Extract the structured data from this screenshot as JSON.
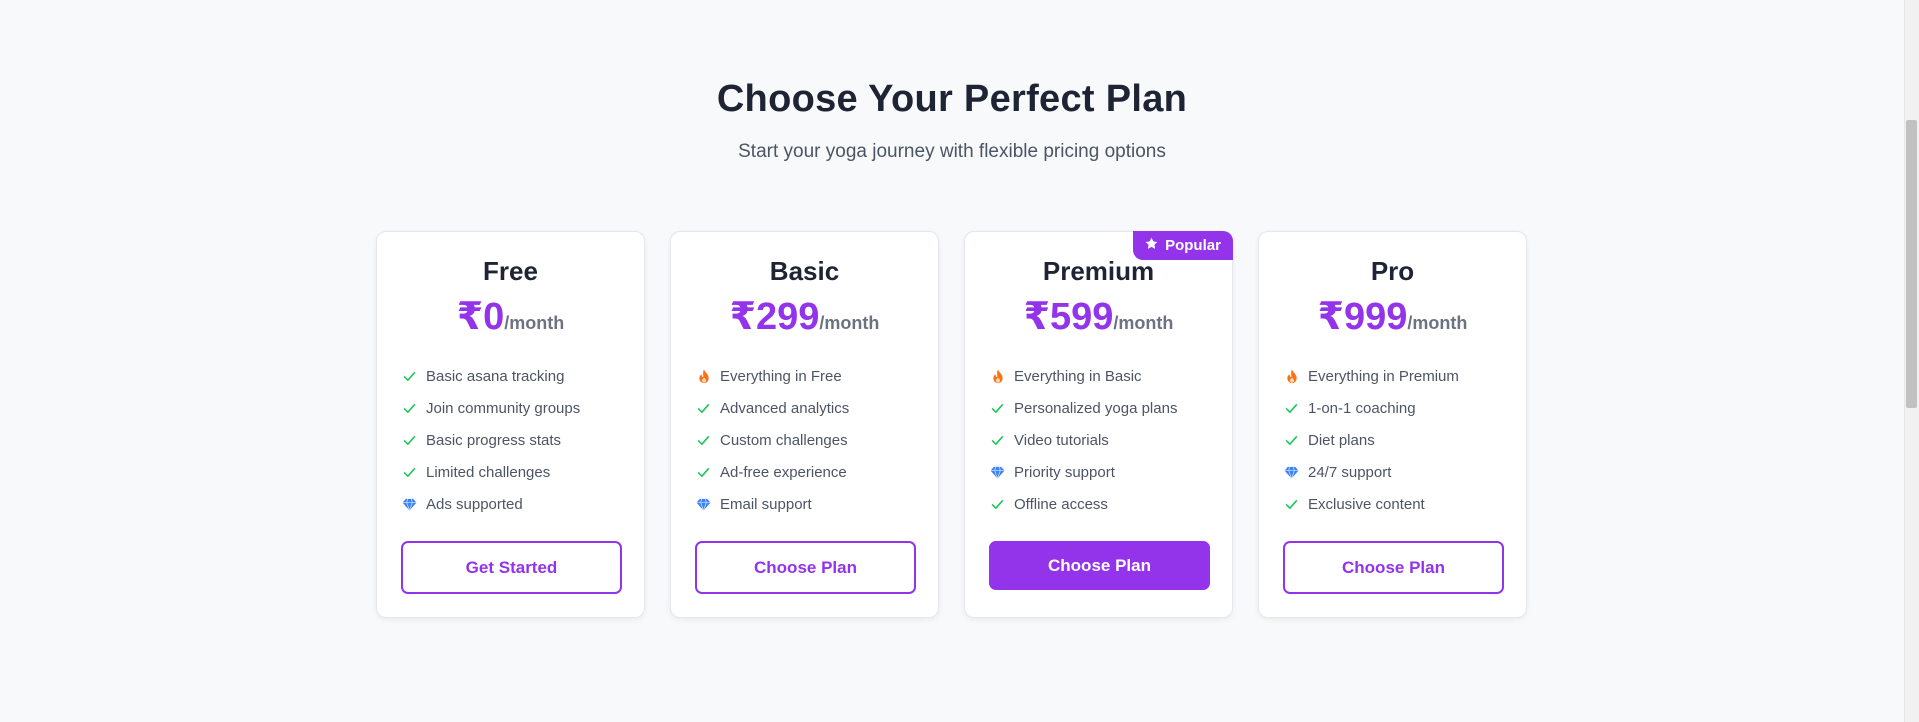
{
  "header": {
    "title": "Choose Your Perfect Plan",
    "subtitle": "Start your yoga journey with flexible pricing options"
  },
  "colors": {
    "accent": "#9333ea",
    "check": "#22c55e",
    "fire": "#f97316",
    "diamond": "#3b82f6"
  },
  "plans": [
    {
      "name": "Free",
      "price": "₹0",
      "period": "/month",
      "features": [
        {
          "icon": "check-icon",
          "text": "Basic asana tracking"
        },
        {
          "icon": "check-icon",
          "text": "Join community groups"
        },
        {
          "icon": "check-icon",
          "text": "Basic progress stats"
        },
        {
          "icon": "check-icon",
          "text": "Limited challenges"
        },
        {
          "icon": "diamond-icon",
          "text": "Ads supported"
        }
      ],
      "button": "Get Started"
    },
    {
      "name": "Basic",
      "price": "₹299",
      "period": "/month",
      "features": [
        {
          "icon": "fire-icon",
          "text": "Everything in Free"
        },
        {
          "icon": "check-icon",
          "text": "Advanced analytics"
        },
        {
          "icon": "check-icon",
          "text": "Custom challenges"
        },
        {
          "icon": "check-icon",
          "text": "Ad-free experience"
        },
        {
          "icon": "diamond-icon",
          "text": "Email support"
        }
      ],
      "button": "Choose Plan"
    },
    {
      "name": "Premium",
      "price": "₹599",
      "period": "/month",
      "badge": "Popular",
      "badge_icon": "star-icon",
      "features": [
        {
          "icon": "fire-icon",
          "text": "Everything in Basic"
        },
        {
          "icon": "check-icon",
          "text": "Personalized yoga plans"
        },
        {
          "icon": "check-icon",
          "text": "Video tutorials"
        },
        {
          "icon": "diamond-icon",
          "text": "Priority support"
        },
        {
          "icon": "check-icon",
          "text": "Offline access"
        }
      ],
      "button": "Choose Plan"
    },
    {
      "name": "Pro",
      "price": "₹999",
      "period": "/month",
      "features": [
        {
          "icon": "fire-icon",
          "text": "Everything in Premium"
        },
        {
          "icon": "check-icon",
          "text": "1-on-1 coaching"
        },
        {
          "icon": "check-icon",
          "text": "Diet plans"
        },
        {
          "icon": "diamond-icon",
          "text": "24/7 support"
        },
        {
          "icon": "check-icon",
          "text": "Exclusive content"
        }
      ],
      "button": "Choose Plan"
    }
  ]
}
